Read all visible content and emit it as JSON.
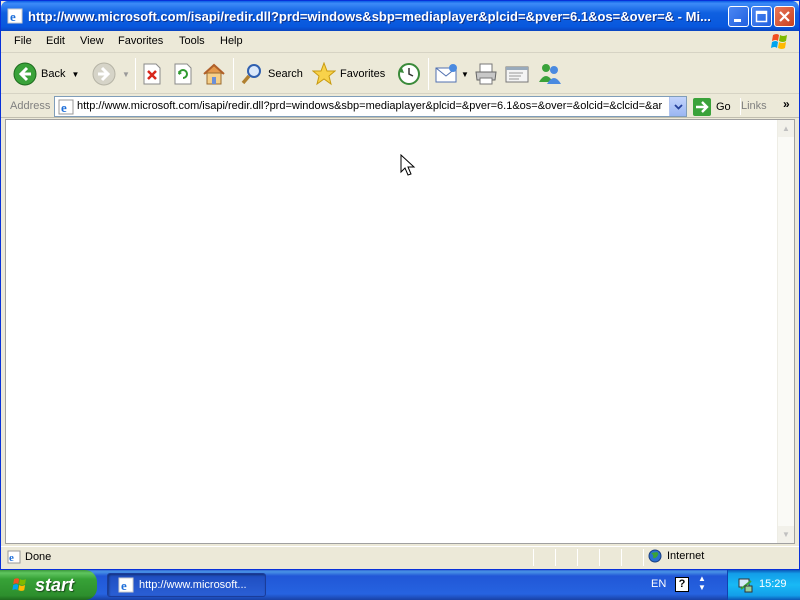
{
  "window": {
    "title": "http://www.microsoft.com/isapi/redir.dll?prd=windows&sbp=mediaplayer&plcid=&pver=6.1&os=&over=& - Mi..."
  },
  "menu": {
    "items": [
      "File",
      "Edit",
      "View",
      "Favorites",
      "Tools",
      "Help"
    ]
  },
  "toolbar": {
    "back_label": "Back",
    "search_label": "Search",
    "favorites_label": "Favorites"
  },
  "address": {
    "label": "Address",
    "url": "http://www.microsoft.com/isapi/redir.dll?prd=windows&sbp=mediaplayer&plcid=&pver=6.1&os=&over=&olcid=&clcid=&ar",
    "go_label": "Go",
    "links_label": "Links",
    "links_chevron": "»"
  },
  "status": {
    "text": "Done",
    "zone": "Internet"
  },
  "taskbar": {
    "start_label": "start",
    "task_label": "http://www.microsoft...",
    "lang": "EN",
    "help": "?",
    "clock": "15:29"
  },
  "colors": {
    "title_blue": "#0858de",
    "start_green": "#37a237",
    "tray_blue": "#18b9f5"
  },
  "icons": [
    "ie-icon",
    "minimize-icon",
    "maximize-icon",
    "close-icon",
    "windows-flag-icon",
    "back-icon",
    "forward-icon",
    "stop-icon",
    "refresh-icon",
    "home-icon",
    "search-icon",
    "favorites-icon",
    "history-icon",
    "mail-icon",
    "print-icon",
    "edit-icon",
    "messenger-icon",
    "go-icon",
    "globe-icon",
    "mouse-cursor-icon",
    "network-icon"
  ]
}
